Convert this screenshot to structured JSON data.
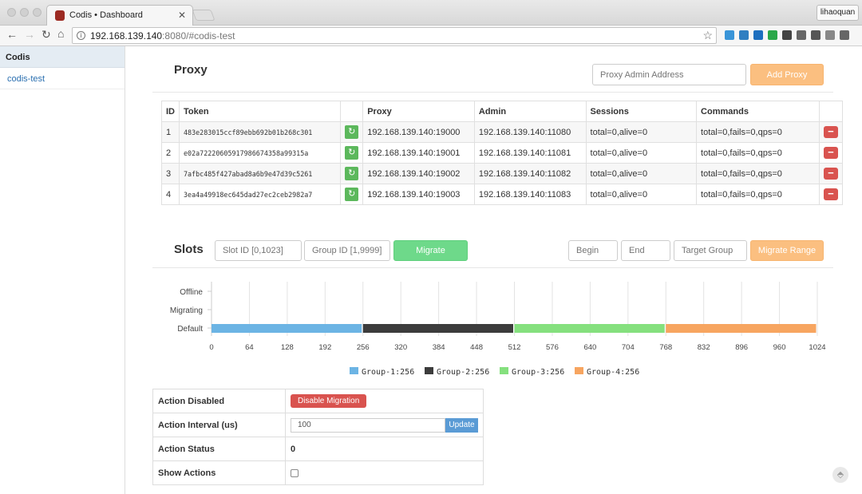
{
  "browser": {
    "tab_title": "Codis • Dashboard",
    "tab_close": "✕",
    "user_button": "lihaoquan",
    "url_host": "192.168.139.140",
    "url_rest": ":8080/#codis-test",
    "icons": {
      "back": "back-arrow-icon",
      "forward": "forward-arrow-icon",
      "reload": "reload-icon",
      "home": "home-icon",
      "info": "info-icon",
      "star": "bookmark-star-icon"
    },
    "extension_colors": [
      "#3a95d8",
      "#2f7fc1",
      "#1d6fbf",
      "#2aa84a",
      "#444",
      "#666",
      "#555",
      "#888",
      "#666"
    ]
  },
  "sidebar": {
    "title": "Codis",
    "items": [
      {
        "label": "codis-test"
      }
    ]
  },
  "proxy": {
    "title": "Proxy",
    "admin_placeholder": "Proxy Admin Address",
    "add_label": "Add Proxy",
    "columns": [
      "ID",
      "Token",
      "",
      "Proxy",
      "Admin",
      "Sessions",
      "Commands",
      ""
    ],
    "rows": [
      {
        "id": "1",
        "token": "483e283015ccf89ebb692b01b268c301",
        "proxy": "192.168.139.140:19000",
        "admin": "192.168.139.140:11080",
        "sessions": "total=0,alive=0",
        "commands": "total=0,fails=0,qps=0"
      },
      {
        "id": "2",
        "token": "e02a72220605917986674358a99315a",
        "proxy": "192.168.139.140:19001",
        "admin": "192.168.139.140:11081",
        "sessions": "total=0,alive=0",
        "commands": "total=0,fails=0,qps=0"
      },
      {
        "id": "3",
        "token": "7afbc485f427abad8a6b9e47d39c5261",
        "proxy": "192.168.139.140:19002",
        "admin": "192.168.139.140:11082",
        "sessions": "total=0,alive=0",
        "commands": "total=0,fails=0,qps=0"
      },
      {
        "id": "4",
        "token": "3ea4a49918ec645dad27ec2ceb2982a7",
        "proxy": "192.168.139.140:19003",
        "admin": "192.168.139.140:11083",
        "sessions": "total=0,alive=0",
        "commands": "total=0,fails=0,qps=0"
      }
    ]
  },
  "slots": {
    "title": "Slots",
    "slot_placeholder": "Slot ID [0,1023]",
    "group_placeholder": "Group ID [1,9999]",
    "migrate_label": "Migrate",
    "begin_placeholder": "Begin",
    "end_placeholder": "End",
    "target_placeholder": "Target Group",
    "migrate_range_label": "Migrate Range"
  },
  "chart_data": {
    "type": "bar",
    "orientation": "horizontal-stacked",
    "categories": [
      "Offline",
      "Migrating",
      "Default"
    ],
    "x_ticks": [
      0,
      64,
      128,
      192,
      256,
      320,
      384,
      448,
      512,
      576,
      640,
      704,
      768,
      832,
      896,
      960,
      1024
    ],
    "xlim": [
      0,
      1024
    ],
    "grid": "vertical",
    "legend": "bottom",
    "series": [
      {
        "name": "Group-1:256",
        "category": "Default",
        "start": 0,
        "end": 256,
        "color": "#6cb4e4"
      },
      {
        "name": "Group-2:256",
        "category": "Default",
        "start": 256,
        "end": 512,
        "color": "#3c3c3c"
      },
      {
        "name": "Group-3:256",
        "category": "Default",
        "start": 512,
        "end": 768,
        "color": "#85e07e"
      },
      {
        "name": "Group-4:256",
        "category": "Default",
        "start": 768,
        "end": 1024,
        "color": "#f7a560"
      }
    ]
  },
  "settings": {
    "rows": {
      "disabled": {
        "label": "Action Disabled",
        "button": "Disable Migration"
      },
      "interval": {
        "label": "Action Interval (us)",
        "value": "100",
        "button": "Update"
      },
      "status": {
        "label": "Action Status",
        "value": "0"
      },
      "show": {
        "label": "Show Actions"
      }
    }
  }
}
